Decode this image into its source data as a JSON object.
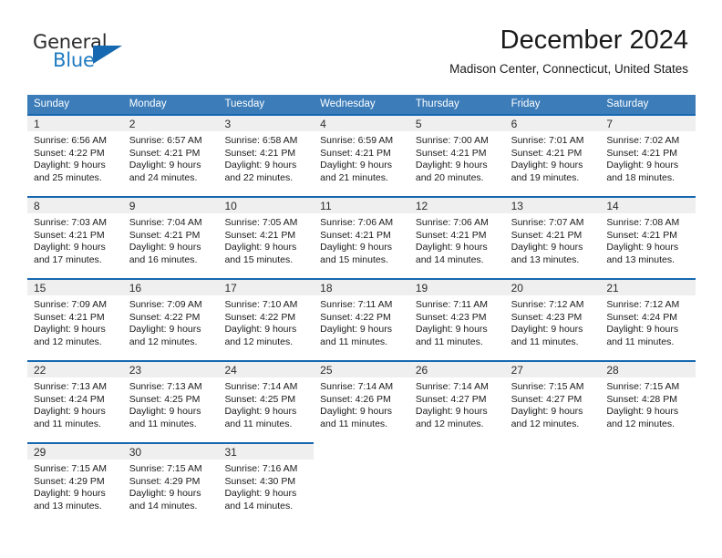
{
  "brand": {
    "name_part1": "General",
    "name_part2": "Blue",
    "accent_color": "#1668b0",
    "triangle_icon": "triangle-logo-icon"
  },
  "header": {
    "month_title": "December 2024",
    "location": "Madison Center, Connecticut, United States"
  },
  "calendar": {
    "header_bg": "#3b7cb9",
    "daynum_bg": "#efefef",
    "row_rule_color": "#1668b0",
    "weekdays": [
      "Sunday",
      "Monday",
      "Tuesday",
      "Wednesday",
      "Thursday",
      "Friday",
      "Saturday"
    ],
    "weeks": [
      [
        {
          "day": "1",
          "sunrise": "Sunrise: 6:56 AM",
          "sunset": "Sunset: 4:22 PM",
          "daylight1": "Daylight: 9 hours",
          "daylight2": "and 25 minutes."
        },
        {
          "day": "2",
          "sunrise": "Sunrise: 6:57 AM",
          "sunset": "Sunset: 4:21 PM",
          "daylight1": "Daylight: 9 hours",
          "daylight2": "and 24 minutes."
        },
        {
          "day": "3",
          "sunrise": "Sunrise: 6:58 AM",
          "sunset": "Sunset: 4:21 PM",
          "daylight1": "Daylight: 9 hours",
          "daylight2": "and 22 minutes."
        },
        {
          "day": "4",
          "sunrise": "Sunrise: 6:59 AM",
          "sunset": "Sunset: 4:21 PM",
          "daylight1": "Daylight: 9 hours",
          "daylight2": "and 21 minutes."
        },
        {
          "day": "5",
          "sunrise": "Sunrise: 7:00 AM",
          "sunset": "Sunset: 4:21 PM",
          "daylight1": "Daylight: 9 hours",
          "daylight2": "and 20 minutes."
        },
        {
          "day": "6",
          "sunrise": "Sunrise: 7:01 AM",
          "sunset": "Sunset: 4:21 PM",
          "daylight1": "Daylight: 9 hours",
          "daylight2": "and 19 minutes."
        },
        {
          "day": "7",
          "sunrise": "Sunrise: 7:02 AM",
          "sunset": "Sunset: 4:21 PM",
          "daylight1": "Daylight: 9 hours",
          "daylight2": "and 18 minutes."
        }
      ],
      [
        {
          "day": "8",
          "sunrise": "Sunrise: 7:03 AM",
          "sunset": "Sunset: 4:21 PM",
          "daylight1": "Daylight: 9 hours",
          "daylight2": "and 17 minutes."
        },
        {
          "day": "9",
          "sunrise": "Sunrise: 7:04 AM",
          "sunset": "Sunset: 4:21 PM",
          "daylight1": "Daylight: 9 hours",
          "daylight2": "and 16 minutes."
        },
        {
          "day": "10",
          "sunrise": "Sunrise: 7:05 AM",
          "sunset": "Sunset: 4:21 PM",
          "daylight1": "Daylight: 9 hours",
          "daylight2": "and 15 minutes."
        },
        {
          "day": "11",
          "sunrise": "Sunrise: 7:06 AM",
          "sunset": "Sunset: 4:21 PM",
          "daylight1": "Daylight: 9 hours",
          "daylight2": "and 15 minutes."
        },
        {
          "day": "12",
          "sunrise": "Sunrise: 7:06 AM",
          "sunset": "Sunset: 4:21 PM",
          "daylight1": "Daylight: 9 hours",
          "daylight2": "and 14 minutes."
        },
        {
          "day": "13",
          "sunrise": "Sunrise: 7:07 AM",
          "sunset": "Sunset: 4:21 PM",
          "daylight1": "Daylight: 9 hours",
          "daylight2": "and 13 minutes."
        },
        {
          "day": "14",
          "sunrise": "Sunrise: 7:08 AM",
          "sunset": "Sunset: 4:21 PM",
          "daylight1": "Daylight: 9 hours",
          "daylight2": "and 13 minutes."
        }
      ],
      [
        {
          "day": "15",
          "sunrise": "Sunrise: 7:09 AM",
          "sunset": "Sunset: 4:21 PM",
          "daylight1": "Daylight: 9 hours",
          "daylight2": "and 12 minutes."
        },
        {
          "day": "16",
          "sunrise": "Sunrise: 7:09 AM",
          "sunset": "Sunset: 4:22 PM",
          "daylight1": "Daylight: 9 hours",
          "daylight2": "and 12 minutes."
        },
        {
          "day": "17",
          "sunrise": "Sunrise: 7:10 AM",
          "sunset": "Sunset: 4:22 PM",
          "daylight1": "Daylight: 9 hours",
          "daylight2": "and 12 minutes."
        },
        {
          "day": "18",
          "sunrise": "Sunrise: 7:11 AM",
          "sunset": "Sunset: 4:22 PM",
          "daylight1": "Daylight: 9 hours",
          "daylight2": "and 11 minutes."
        },
        {
          "day": "19",
          "sunrise": "Sunrise: 7:11 AM",
          "sunset": "Sunset: 4:23 PM",
          "daylight1": "Daylight: 9 hours",
          "daylight2": "and 11 minutes."
        },
        {
          "day": "20",
          "sunrise": "Sunrise: 7:12 AM",
          "sunset": "Sunset: 4:23 PM",
          "daylight1": "Daylight: 9 hours",
          "daylight2": "and 11 minutes."
        },
        {
          "day": "21",
          "sunrise": "Sunrise: 7:12 AM",
          "sunset": "Sunset: 4:24 PM",
          "daylight1": "Daylight: 9 hours",
          "daylight2": "and 11 minutes."
        }
      ],
      [
        {
          "day": "22",
          "sunrise": "Sunrise: 7:13 AM",
          "sunset": "Sunset: 4:24 PM",
          "daylight1": "Daylight: 9 hours",
          "daylight2": "and 11 minutes."
        },
        {
          "day": "23",
          "sunrise": "Sunrise: 7:13 AM",
          "sunset": "Sunset: 4:25 PM",
          "daylight1": "Daylight: 9 hours",
          "daylight2": "and 11 minutes."
        },
        {
          "day": "24",
          "sunrise": "Sunrise: 7:14 AM",
          "sunset": "Sunset: 4:25 PM",
          "daylight1": "Daylight: 9 hours",
          "daylight2": "and 11 minutes."
        },
        {
          "day": "25",
          "sunrise": "Sunrise: 7:14 AM",
          "sunset": "Sunset: 4:26 PM",
          "daylight1": "Daylight: 9 hours",
          "daylight2": "and 11 minutes."
        },
        {
          "day": "26",
          "sunrise": "Sunrise: 7:14 AM",
          "sunset": "Sunset: 4:27 PM",
          "daylight1": "Daylight: 9 hours",
          "daylight2": "and 12 minutes."
        },
        {
          "day": "27",
          "sunrise": "Sunrise: 7:15 AM",
          "sunset": "Sunset: 4:27 PM",
          "daylight1": "Daylight: 9 hours",
          "daylight2": "and 12 minutes."
        },
        {
          "day": "28",
          "sunrise": "Sunrise: 7:15 AM",
          "sunset": "Sunset: 4:28 PM",
          "daylight1": "Daylight: 9 hours",
          "daylight2": "and 12 minutes."
        }
      ],
      [
        {
          "day": "29",
          "sunrise": "Sunrise: 7:15 AM",
          "sunset": "Sunset: 4:29 PM",
          "daylight1": "Daylight: 9 hours",
          "daylight2": "and 13 minutes."
        },
        {
          "day": "30",
          "sunrise": "Sunrise: 7:15 AM",
          "sunset": "Sunset: 4:29 PM",
          "daylight1": "Daylight: 9 hours",
          "daylight2": "and 14 minutes."
        },
        {
          "day": "31",
          "sunrise": "Sunrise: 7:16 AM",
          "sunset": "Sunset: 4:30 PM",
          "daylight1": "Daylight: 9 hours",
          "daylight2": "and 14 minutes."
        },
        {
          "day": "",
          "sunrise": "",
          "sunset": "",
          "daylight1": "",
          "daylight2": ""
        },
        {
          "day": "",
          "sunrise": "",
          "sunset": "",
          "daylight1": "",
          "daylight2": ""
        },
        {
          "day": "",
          "sunrise": "",
          "sunset": "",
          "daylight1": "",
          "daylight2": ""
        },
        {
          "day": "",
          "sunrise": "",
          "sunset": "",
          "daylight1": "",
          "daylight2": ""
        }
      ]
    ]
  }
}
